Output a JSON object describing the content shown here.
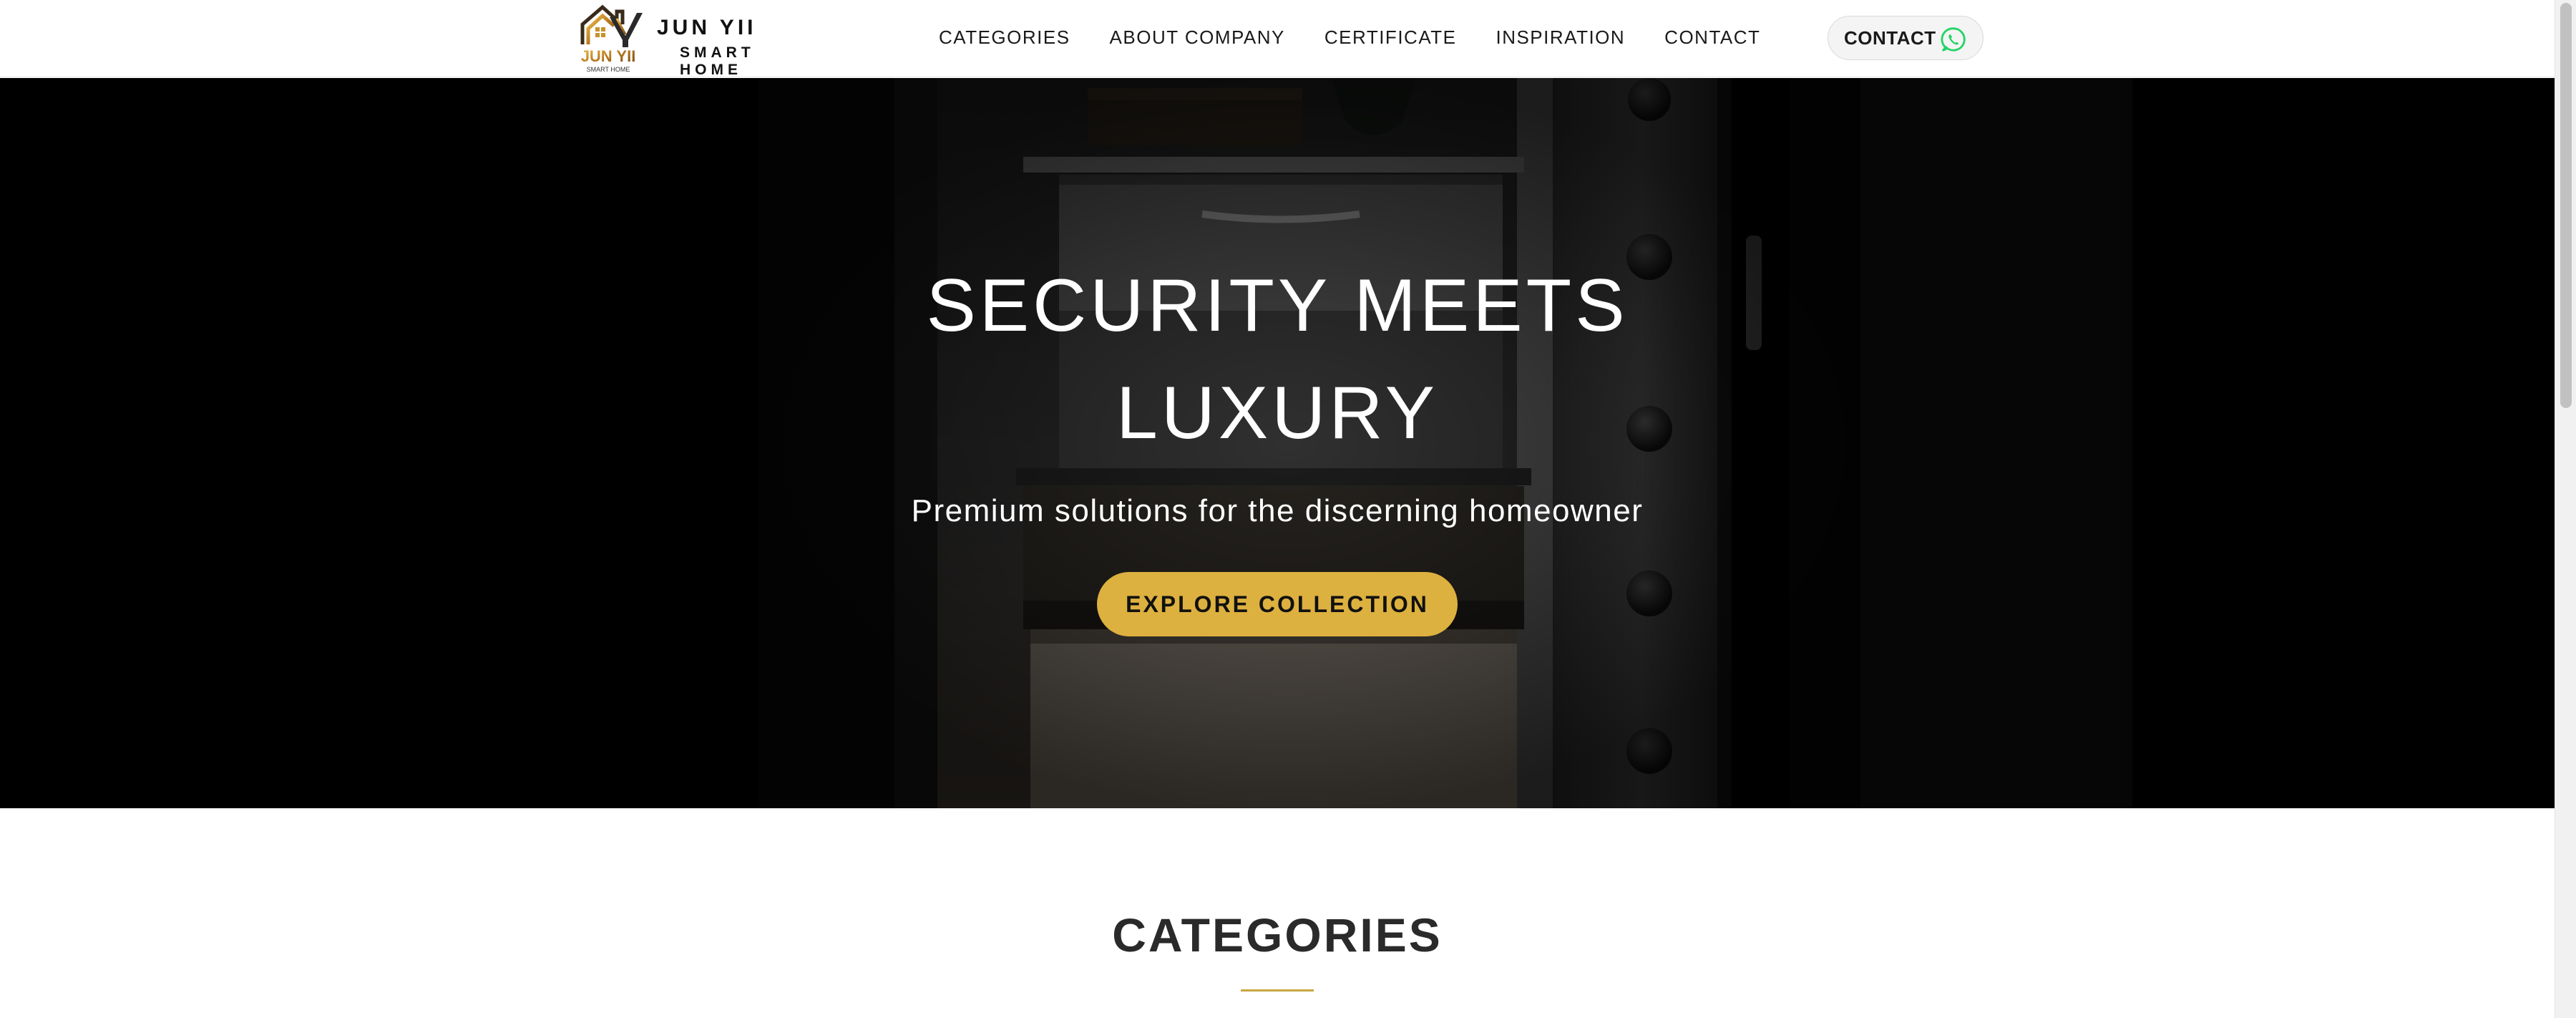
{
  "brand": {
    "logo_mark_text": "JUN YII",
    "logo_mark_sub": "SMART HOME",
    "name": "JUN YII",
    "subtitle": "SMART HOME",
    "accent_color": "#ddb13f"
  },
  "nav": {
    "items": [
      {
        "label": "CATEGORIES"
      },
      {
        "label": "ABOUT COMPANY"
      },
      {
        "label": "CERTIFICATE"
      },
      {
        "label": "INSPIRATION"
      },
      {
        "label": "CONTACT"
      }
    ]
  },
  "header_contact": {
    "label": "CONTACT",
    "icon": "whatsapp-icon",
    "icon_color": "#25d366"
  },
  "hero": {
    "title_line1": "SECURITY MEETS",
    "title_line2": "LUXURY",
    "subtitle": "Premium solutions for the discerning homeowner",
    "cta_label": "EXPLORE COLLECTION",
    "background": "safe-interior-photo"
  },
  "categories": {
    "heading": "CATEGORIES"
  }
}
